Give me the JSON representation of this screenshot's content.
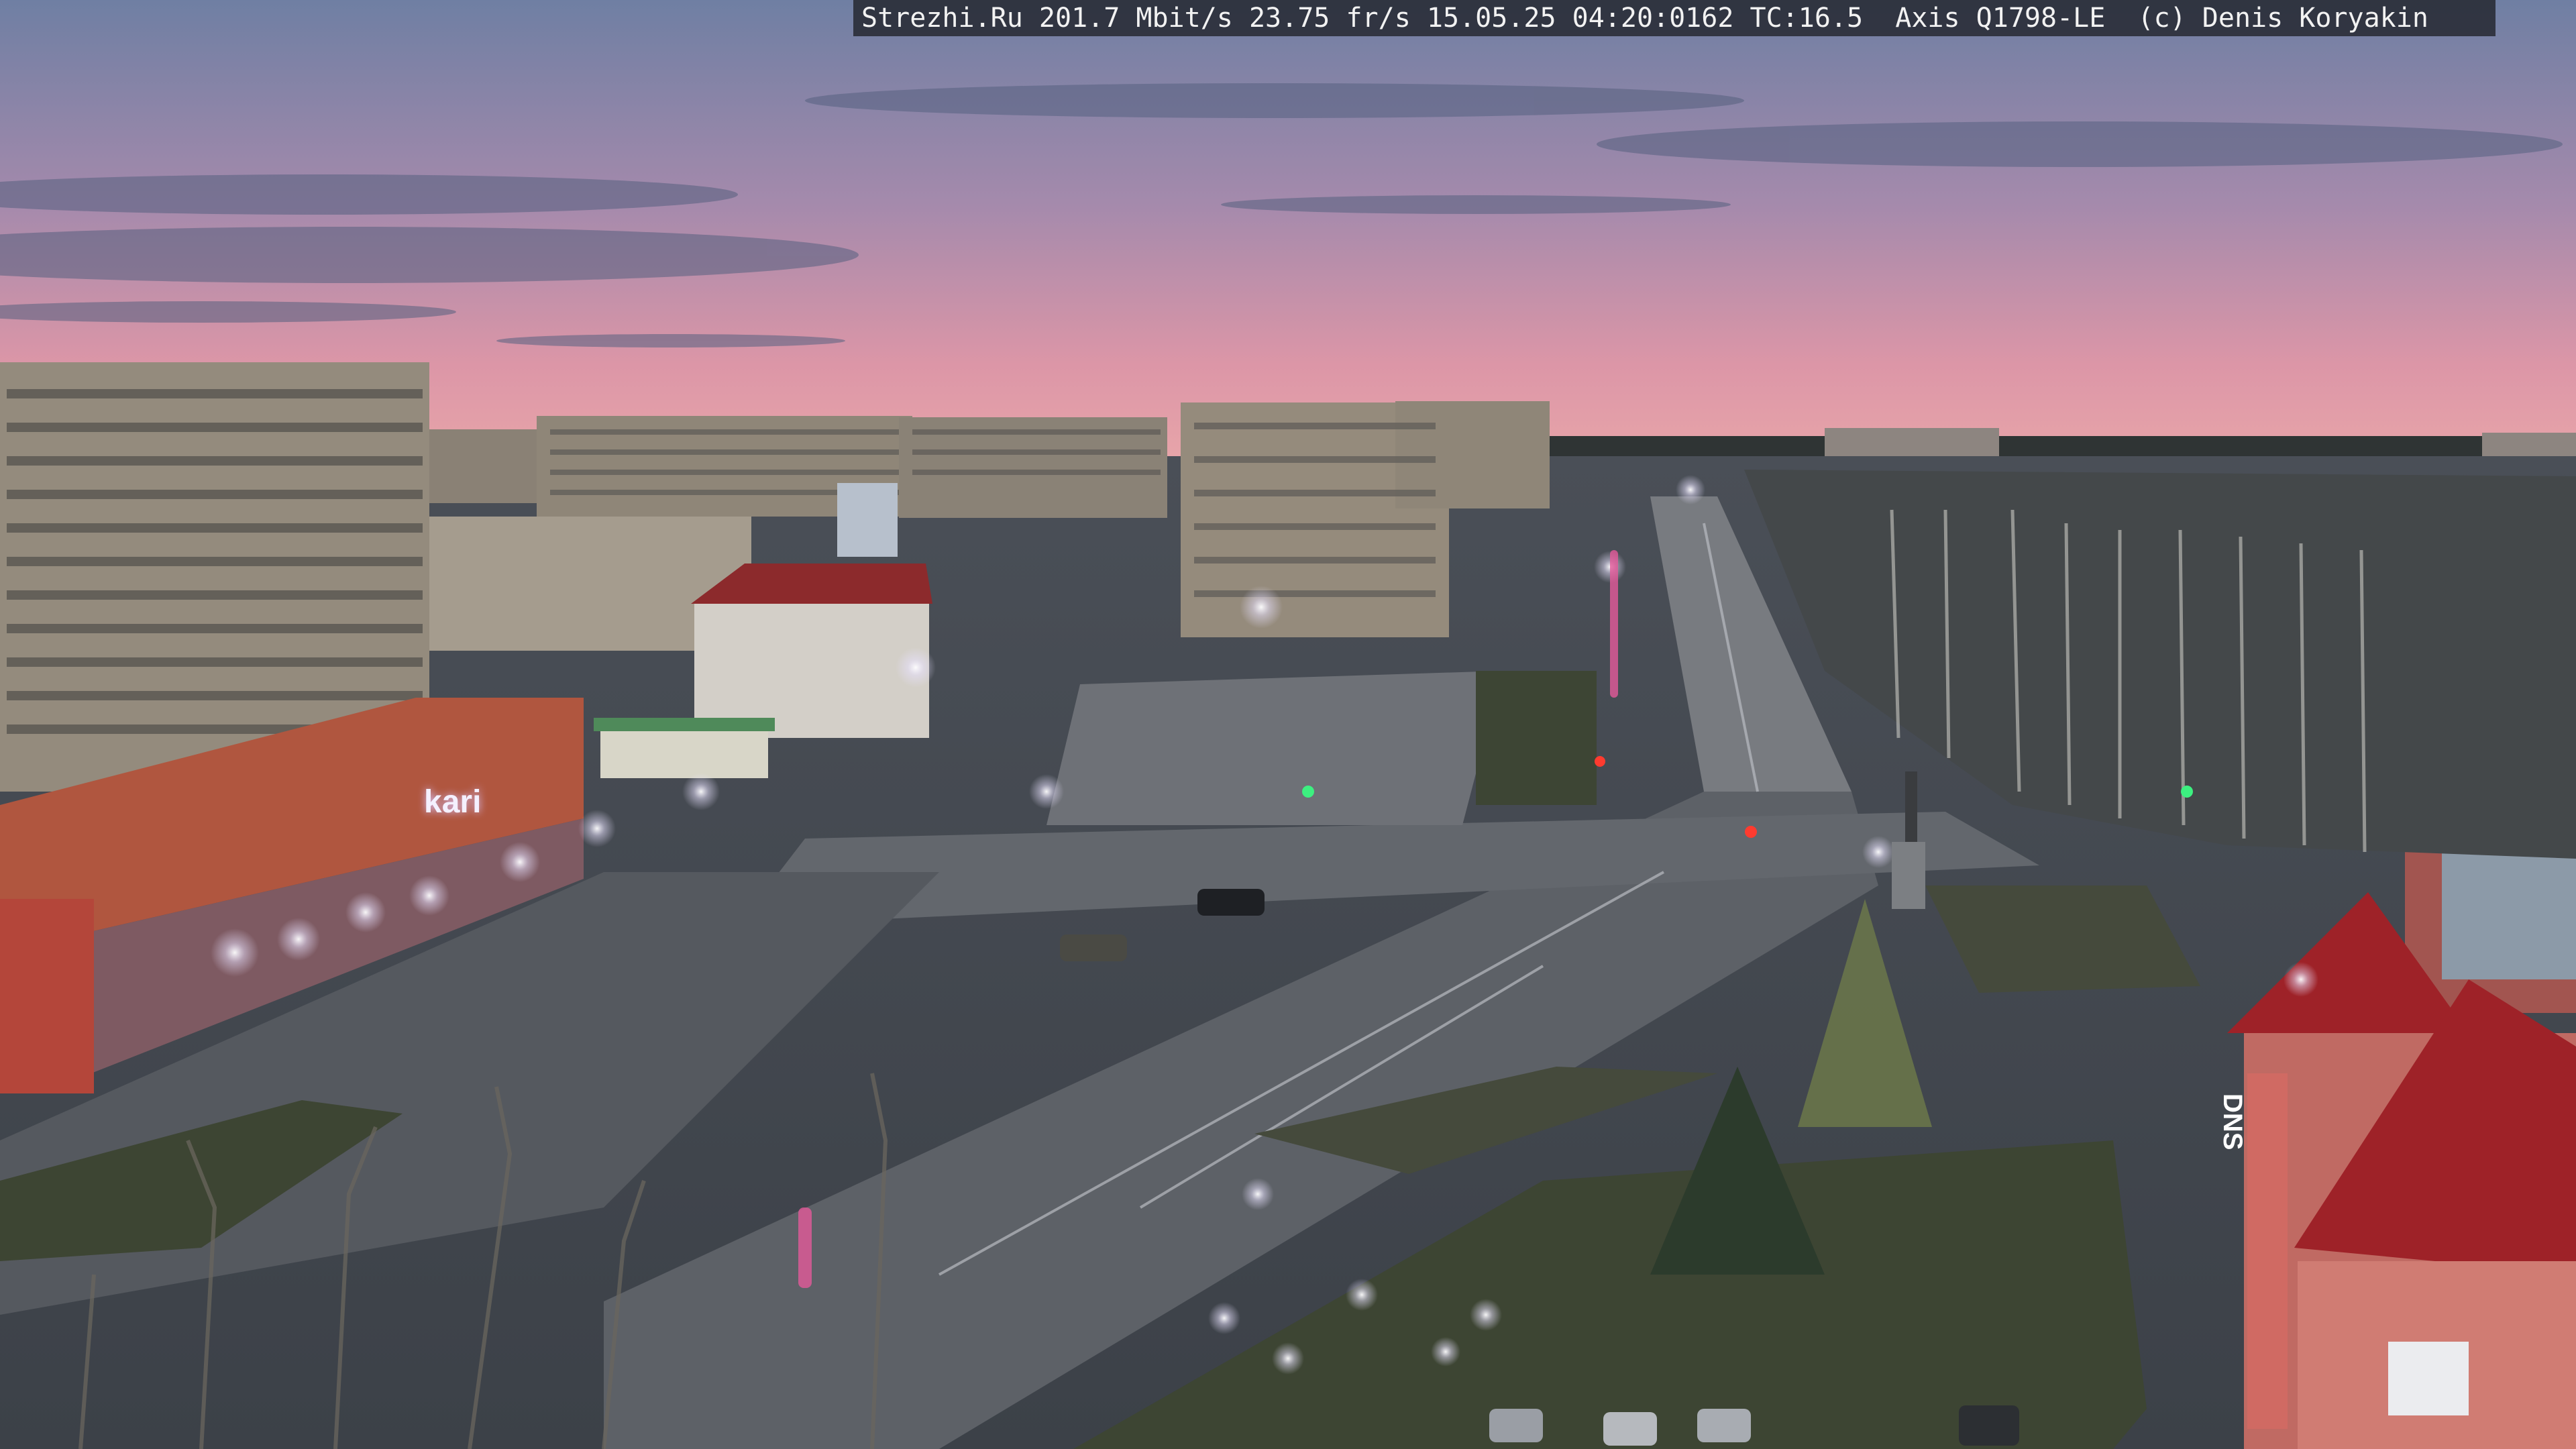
{
  "overlay": {
    "text": "Strezhi.Ru 201.7 Mbit/s 23.75 fr/s 15.05.25 04:20:0162 TC:16.5  Axis Q1798-LE  (c) Denis Koryakin"
  },
  "signs": {
    "store_left": "kari",
    "store_right": "DNS"
  },
  "colors": {
    "sky_top": "#6f7fa3",
    "sky_mid": "#b98aa8",
    "sky_horizon": "#e69aa6",
    "road": "#5c6066",
    "grass": "#3f4736",
    "building_beige": "#8f8675",
    "building_red": "#a8483e",
    "roof_red": "#a3202a",
    "street_light": "#f2ecff"
  }
}
